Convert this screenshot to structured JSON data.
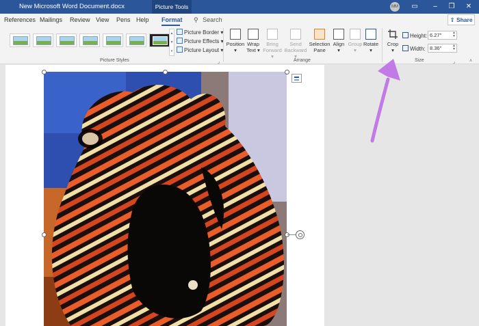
{
  "titlebar": {
    "document_title": "New Microsoft Word Document.docx",
    "context_tab": "Picture Tools",
    "user_initials": "MM"
  },
  "tabs": [
    "References",
    "Mailings",
    "Review",
    "View",
    "Pens",
    "Help",
    "Format"
  ],
  "active_tab": "Format",
  "search": {
    "label": "Search"
  },
  "share_label": "Share",
  "ribbon": {
    "picture_styles": {
      "label": "Picture Styles",
      "commands": [
        "Picture Border",
        "Picture Effects",
        "Picture Layout"
      ]
    },
    "arrange": {
      "label": "Arrange",
      "position": "Position",
      "wrap_text": [
        "Wrap",
        "Text"
      ],
      "bring_forward": [
        "Bring",
        "Forward"
      ],
      "send_backward": [
        "Send",
        "Backward"
      ],
      "selection_pane": [
        "Selection",
        "Pane"
      ],
      "align": "Align",
      "group": "Group",
      "rotate": "Rotate"
    },
    "size": {
      "label": "Size",
      "crop": "Crop",
      "height_label": "Height:",
      "height_value": "6.27\"",
      "width_label": "Width:",
      "width_value": "8.36\""
    }
  },
  "colors": {
    "title_bar": "#2b579a",
    "accent": "#2b579a",
    "annotation_arrow": "#c27ae6"
  },
  "icons": {
    "picture_border": "picture-border-icon",
    "crop": "crop-icon",
    "layout_options": "layout-options-icon",
    "rotate_handle": "rotate-handle-icon"
  }
}
